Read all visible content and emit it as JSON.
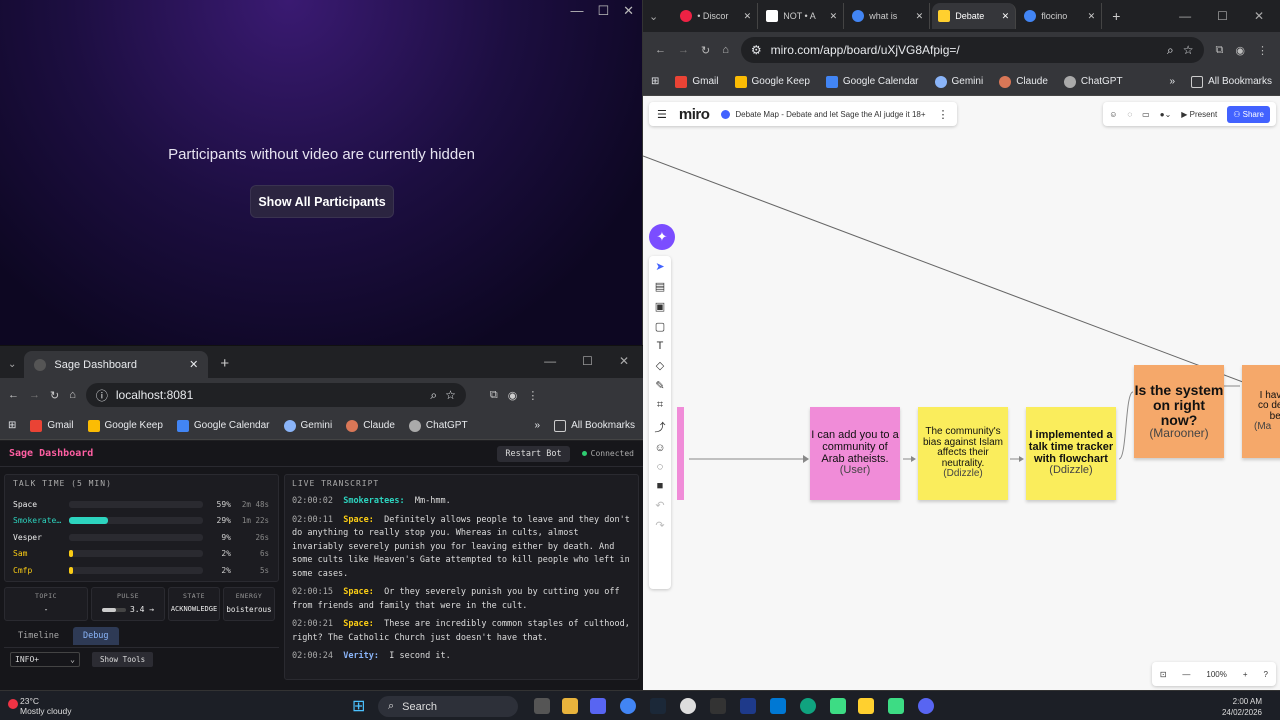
{
  "video_window": {
    "message": "Participants without video are currently hidden",
    "button": "Show All Participants"
  },
  "sage_browser": {
    "tab_title": "Sage Dashboard",
    "url": "localhost:8081",
    "bookmarks": [
      "Gmail",
      "Google Keep",
      "Google Calendar",
      "Gemini",
      "Claude",
      "ChatGPT"
    ],
    "all_bookmarks": "All Bookmarks"
  },
  "dashboard": {
    "title": "Sage Dashboard",
    "restart": "Restart Bot",
    "status": "Connected",
    "talk_title": "TALK TIME (5 MIN)",
    "speakers": [
      {
        "name": "Space",
        "pct": "59%",
        "time": "2m 48s",
        "value": 0.59,
        "color": "#2a2a30"
      },
      {
        "name": "Smokerate…",
        "pct": "29%",
        "time": "1m 22s",
        "value": 0.29,
        "color": "#2dd4bf"
      },
      {
        "name": "Vesper",
        "pct": "9%",
        "time": "26s",
        "value": 0.09,
        "color": "#2a2a30"
      },
      {
        "name": "Sam",
        "pct": "2%",
        "time": "6s",
        "value": 0.02,
        "color": "#facc15"
      },
      {
        "name": "Cmfp",
        "pct": "2%",
        "time": "5s",
        "value": 0.02,
        "color": "#facc15"
      }
    ],
    "stats": {
      "topic_label": "TOPIC",
      "topic_value": "-",
      "pulse_label": "PULSE",
      "pulse_value": "3.4 →",
      "state_label": "STATE",
      "state_value": "ACKNOWLEDGE",
      "energy_label": "ENERGY",
      "energy_value": "boisterous"
    },
    "tabs": [
      "Timeline",
      "Debug"
    ],
    "log_level": "INFO+",
    "show_tools": "Show Tools",
    "transcript_title": "LIVE TRANSCRIPT",
    "transcript": [
      {
        "time": "02:00:02",
        "speaker": "Smokeratees:",
        "text": "Mm-hmm.",
        "color": "#2dd4bf"
      },
      {
        "time": "02:00:11",
        "speaker": "Space:",
        "text": "Definitely allows people to leave and they don't do anything to really stop you. Whereas in cults, almost invariably severely punish you for leaving either by death. And some cults like Heaven's Gate attempted to kill people who left in some cases.",
        "color": "#facc15"
      },
      {
        "time": "02:00:15",
        "speaker": "Space:",
        "text": "Or they severely punish you by cutting you off from friends and family that were in the cult.",
        "color": "#facc15"
      },
      {
        "time": "02:00:21",
        "speaker": "Space:",
        "text": "These are incredibly common staples of culthood, right? The Catholic Church just doesn't have that.",
        "color": "#facc15"
      },
      {
        "time": "02:00:24",
        "speaker": "Verity:",
        "text": "I second it.",
        "color": "#8ab4f8"
      }
    ]
  },
  "right_browser": {
    "tabs": [
      "• Discor",
      "NOT • A",
      "what is",
      "Debate",
      "flocino"
    ],
    "url": "miro.com/app/board/uXjVG8Afpig=/",
    "bookmarks": [
      "Gmail",
      "Google Keep",
      "Google Calendar",
      "Gemini",
      "Claude",
      "ChatGPT"
    ],
    "all_bookmarks": "All Bookmarks"
  },
  "miro": {
    "logo": "miro",
    "board_name": "Debate Map - Debate and let Sage the AI judge it 18+",
    "present": "Present",
    "share": "Share",
    "zoom": "100%",
    "notes": [
      {
        "text": "I can add you to a community of Arab atheists.",
        "by": "(User)"
      },
      {
        "text": "The community's bias against Islam affects their neutrality.",
        "by": "(Ddizzle)"
      },
      {
        "text": "I implemented a talk time tracker with flowchart",
        "by": "(Ddizzle)"
      },
      {
        "text": "Is the system on right now?",
        "by": "(Marooner)"
      },
      {
        "text": "I hav wit co despit beh",
        "by": "(Ma"
      }
    ]
  },
  "taskbar": {
    "temp": "23°C",
    "weather": "Mostly cloudy",
    "search": "Search",
    "time": "2:00 AM",
    "date": "24/02/2026"
  }
}
